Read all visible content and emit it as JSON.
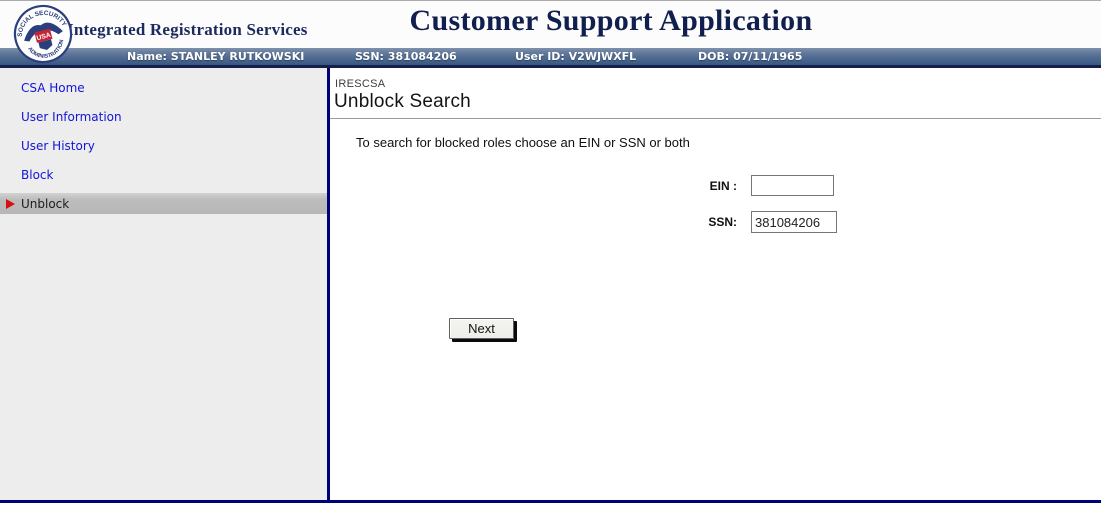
{
  "header": {
    "brand": "Integrated Registration Services",
    "title": "Customer Support Application",
    "logo": {
      "arc_top": "SOCIAL SECURITY",
      "arc_bottom": "ADMINISTRATION",
      "usa": "USA"
    }
  },
  "user_bar": {
    "name": "Name: STANLEY RUTKOWSKI",
    "ssn": "SSN: 381084206",
    "user_id": "User ID: V2WJWXFL",
    "dob": "DOB: 07/11/1965"
  },
  "sidebar": {
    "items": [
      {
        "label": "CSA Home",
        "selected": false
      },
      {
        "label": "User Information",
        "selected": false
      },
      {
        "label": "User History",
        "selected": false
      },
      {
        "label": "Block",
        "selected": false
      },
      {
        "label": "Unblock",
        "selected": true
      }
    ]
  },
  "main": {
    "app_code": "IRESCSA",
    "page_title": "Unblock Search",
    "instruction": "To search for blocked roles choose an EIN or SSN or both",
    "form": {
      "ein_label": "EIN :",
      "ein_value": "",
      "ssn_label": "SSN:",
      "ssn_value": "381084206",
      "next_label": "Next"
    }
  },
  "colors": {
    "navy_line": "#000079",
    "header_text": "#101f4d",
    "bar_gradient_top": "#7e91ab",
    "bar_gradient_bottom": "#3a577f",
    "link_blue": "#1414d6",
    "selected_gray": "#bdbdbd",
    "arrow_red": "#d80f0f",
    "sidebar_bg": "#ededee"
  }
}
